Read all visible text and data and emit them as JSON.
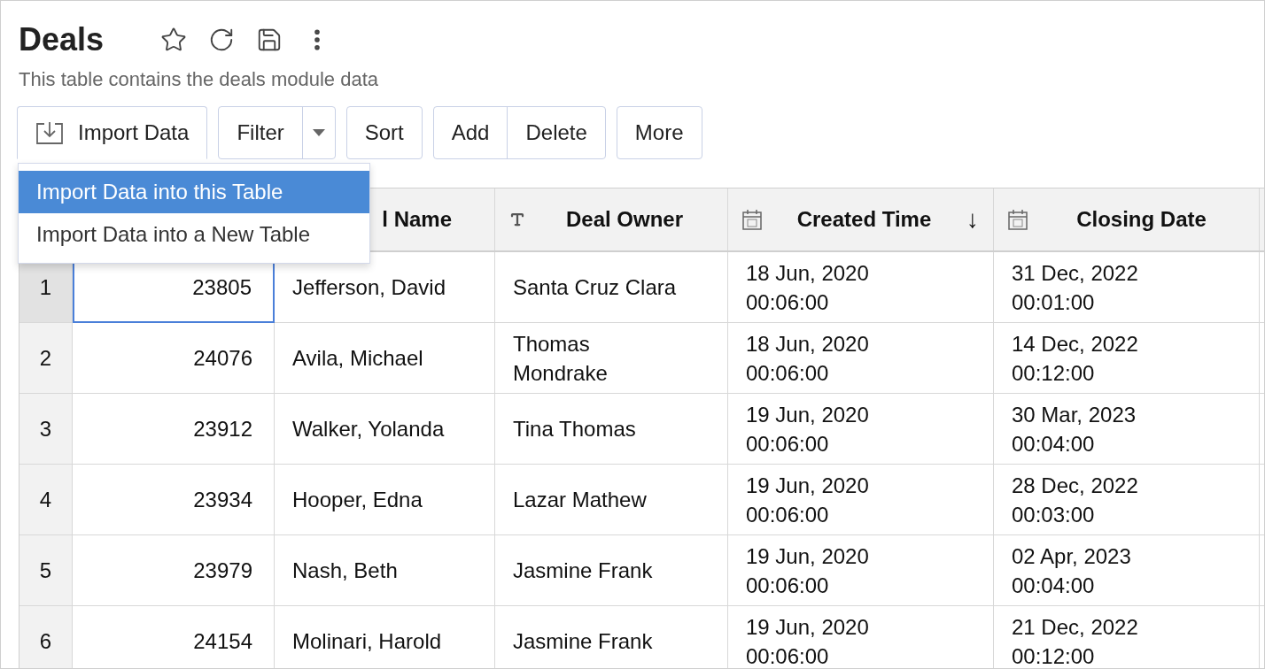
{
  "title": "Deals",
  "subtitle": "This table contains the deals module data",
  "toolbar": {
    "import": {
      "label": "Import Data",
      "expanded": true
    },
    "filter": "Filter",
    "sort": "Sort",
    "add": "Add",
    "delete": "Delete",
    "more": "More"
  },
  "import_menu": [
    {
      "label": "Import Data into this Table",
      "selected": true
    },
    {
      "label": "Import Data into a New Table",
      "selected": false
    }
  ],
  "table": {
    "columns": [
      {
        "label": "l Name"
      },
      {
        "label": "Deal Owner",
        "kind": "text"
      },
      {
        "label": "Created Time",
        "kind": "date",
        "sort_mark": "↓"
      },
      {
        "label": "Closing Date",
        "kind": "date"
      }
    ],
    "rows": [
      {
        "number": "1",
        "selected": true,
        "id": "23805",
        "name": "Jefferson, David",
        "owner": "Santa Cruz Clara",
        "created": {
          "date": "18 Jun, 2020",
          "time": "00:06:00"
        },
        "closing": {
          "date": "31 Dec, 2022",
          "time": "00:01:00"
        }
      },
      {
        "number": "2",
        "selected": false,
        "id": "24076",
        "name": "Avila, Michael",
        "owner": "Thomas Mondrake",
        "created": {
          "date": "18 Jun, 2020",
          "time": "00:06:00"
        },
        "closing": {
          "date": "14 Dec, 2022",
          "time": "00:12:00"
        }
      },
      {
        "number": "3",
        "selected": false,
        "id": "23912",
        "name": "Walker, Yolanda",
        "owner": "Tina Thomas",
        "created": {
          "date": "19 Jun, 2020",
          "time": "00:06:00"
        },
        "closing": {
          "date": "30 Mar, 2023",
          "time": "00:04:00"
        }
      },
      {
        "number": "4",
        "selected": false,
        "id": "23934",
        "name": "Hooper, Edna",
        "owner": "Lazar Mathew",
        "created": {
          "date": "19 Jun, 2020",
          "time": "00:06:00"
        },
        "closing": {
          "date": "28 Dec, 2022",
          "time": "00:03:00"
        }
      },
      {
        "number": "5",
        "selected": false,
        "id": "23979",
        "name": "Nash, Beth",
        "owner": "Jasmine Frank",
        "created": {
          "date": "19 Jun, 2020",
          "time": "00:06:00"
        },
        "closing": {
          "date": "02 Apr, 2023",
          "time": "00:04:00"
        }
      },
      {
        "number": "6",
        "selected": false,
        "id": "24154",
        "name": "Molinari, Harold",
        "owner": "Jasmine Frank",
        "created": {
          "date": "19 Jun, 2020",
          "time": "00:06:00"
        },
        "closing": {
          "date": "21 Dec, 2022",
          "time": "00:12:00"
        }
      }
    ]
  }
}
